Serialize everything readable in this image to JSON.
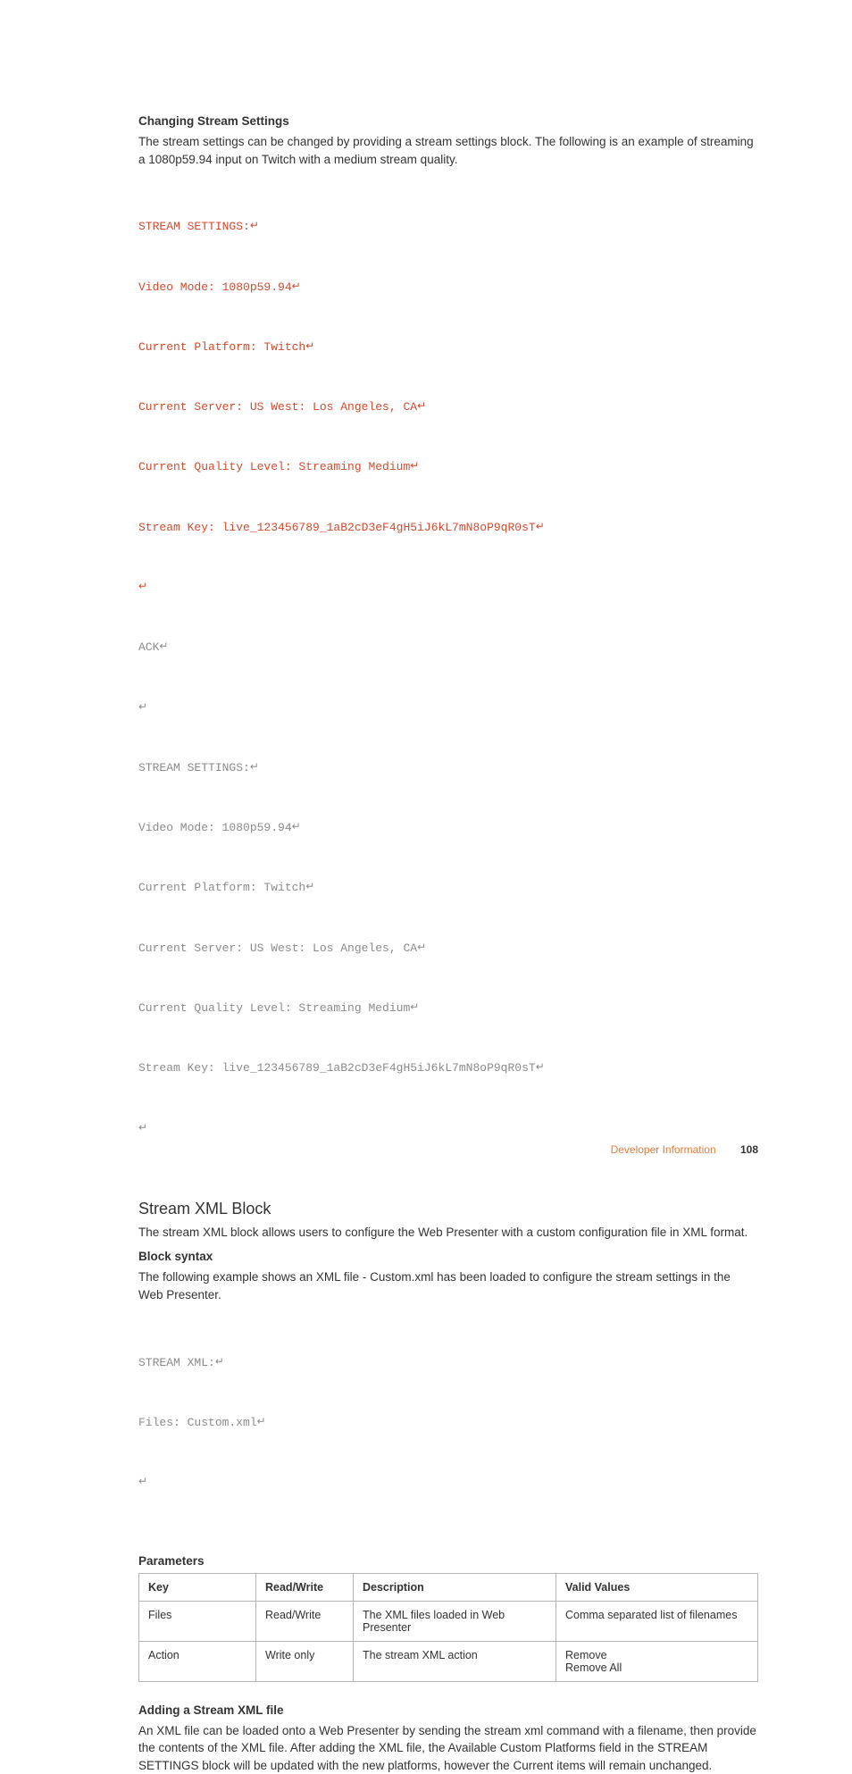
{
  "section1": {
    "heading": "Changing Stream Settings",
    "paragraph": "The stream settings can be changed by providing a stream settings block. The following is an example of streaming a 1080p59.94 input on Twitch with a medium stream quality.",
    "code": {
      "red": [
        "STREAM SETTINGS:",
        "Video Mode: 1080p59.94",
        "Current Platform: Twitch",
        "Current Server: US West: Los Angeles, CA",
        "Current Quality Level: Streaming Medium",
        "Stream Key: live_123456789_1aB2cD3eF4gH5iJ6kL7mN8oP9qR0sT",
        ""
      ],
      "gray": [
        "ACK",
        "",
        "STREAM SETTINGS:",
        "Video Mode: 1080p59.94",
        "Current Platform: Twitch",
        "Current Server: US West: Los Angeles, CA",
        "Current Quality Level: Streaming Medium",
        "Stream Key: live_123456789_1aB2cD3eF4gH5iJ6kL7mN8oP9qR0sT",
        ""
      ]
    }
  },
  "section2": {
    "title": "Stream XML Block",
    "intro": "The stream XML block allows users to configure the Web Presenter with a custom configuration file in XML format.",
    "block_syntax_heading": "Block syntax",
    "block_syntax_text": "The following example shows an XML file - Custom.xml has been loaded to configure the stream settings in the Web Presenter.",
    "code_gray": [
      "STREAM XML:",
      "Files: Custom.xml",
      ""
    ],
    "params_heading": "Parameters",
    "table": {
      "headers": [
        "Key",
        "Read/Write",
        "Description",
        "Valid Values"
      ],
      "rows": [
        [
          "Files",
          "Read/Write",
          "The XML files loaded in Web Presenter",
          "Comma separated list of filenames"
        ],
        [
          "Action",
          "Write only",
          "The stream XML action",
          "Remove\nRemove All"
        ]
      ]
    },
    "adding_heading": "Adding a Stream XML file",
    "adding_text": "An XML file can be loaded onto a Web Presenter by sending the stream xml command with a filename, then provide the contents of the XML file. After adding the XML file, the Available Custom Platforms field in the STREAM SETTINGS block will be updated with the new platforms, however the Current items will remain unchanged."
  },
  "footer": {
    "label": "Developer Information",
    "page": "108"
  },
  "cr_glyph": "↵"
}
